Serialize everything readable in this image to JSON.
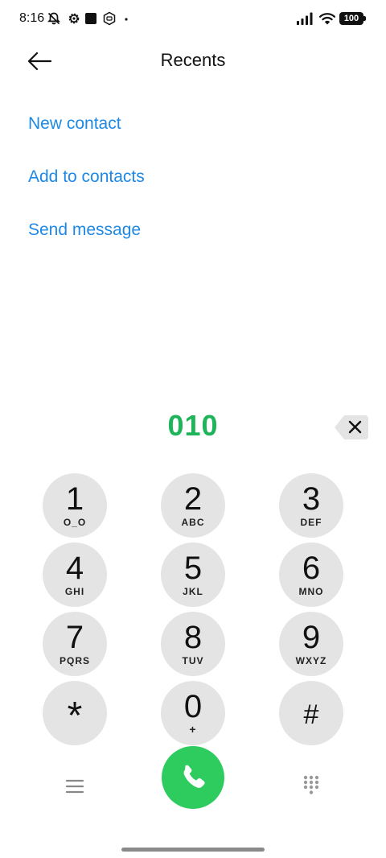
{
  "status_bar": {
    "time": "8:16",
    "battery_level": "100",
    "icons": [
      "bell-off-icon",
      "settings-gear-icon",
      "square-notification-icon",
      "shield-notification-icon",
      "dot-icon",
      "signal-icon",
      "wifi-icon",
      "battery-icon"
    ]
  },
  "header": {
    "back_icon": "arrow-left-icon",
    "title": "Recents"
  },
  "actions": {
    "new_contact": "New contact",
    "add_to_contacts": "Add to contacts",
    "send_message": "Send message"
  },
  "dialer": {
    "number": "010",
    "backspace_icon": "backspace-icon",
    "keys": [
      {
        "digit": "1",
        "letters": "O_O"
      },
      {
        "digit": "2",
        "letters": "ABC"
      },
      {
        "digit": "3",
        "letters": "DEF"
      },
      {
        "digit": "4",
        "letters": "GHI"
      },
      {
        "digit": "5",
        "letters": "JKL"
      },
      {
        "digit": "6",
        "letters": "MNO"
      },
      {
        "digit": "7",
        "letters": "PQRS"
      },
      {
        "digit": "8",
        "letters": "TUV"
      },
      {
        "digit": "9",
        "letters": "WXYZ"
      },
      {
        "digit": "*",
        "letters": ""
      },
      {
        "digit": "0",
        "letters": "+"
      },
      {
        "digit": "#",
        "letters": ""
      }
    ]
  },
  "bottom_bar": {
    "menu_icon": "menu-icon",
    "call_icon": "phone-icon",
    "dialpad_icon": "dialpad-icon"
  },
  "colors": {
    "accent_blue": "#1e88e5",
    "number_green": "#1fb45a",
    "call_green": "#2ecc5f",
    "key_gray": "#e4e4e4"
  }
}
